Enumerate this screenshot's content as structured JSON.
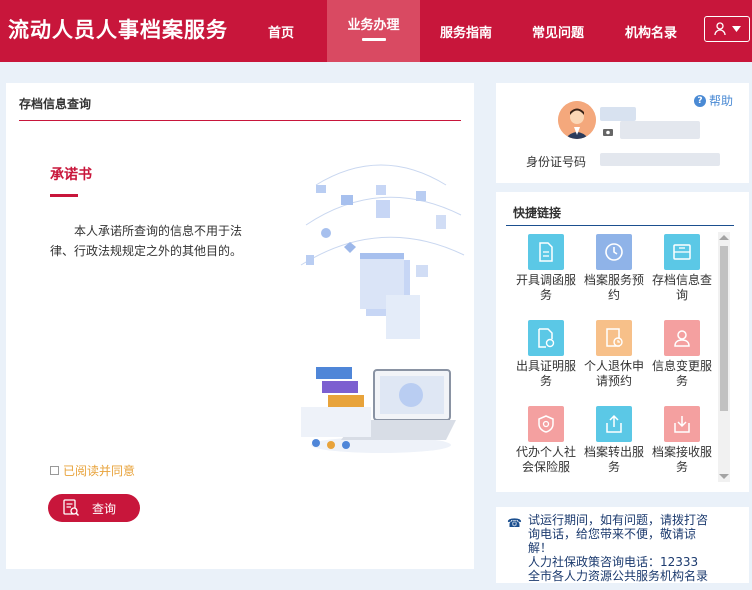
{
  "header": {
    "site_title": "流动人员人事档案服务",
    "nav": [
      "首页",
      "业务办理",
      "服务指南",
      "常见问题",
      "机构名录"
    ],
    "active_nav": "业务办理",
    "user_menu_icon": "user-icon"
  },
  "main": {
    "title": "存档信息查询",
    "pledge_title": "承诺书",
    "pledge_text": "本人承诺所查询的信息不用于法律、行政法规规定之外的其他目的。",
    "agree_label": "已阅读并同意",
    "query_button": "查询"
  },
  "profile": {
    "help": "帮助",
    "id_label": "身份证号码"
  },
  "quick_links": {
    "title": "快捷链接",
    "items": [
      {
        "label": "开具调函服务",
        "icon": "document-icon",
        "color": "#5bc8e6"
      },
      {
        "label": "档案服务预约",
        "icon": "clock-icon",
        "color": "#8fb3e8"
      },
      {
        "label": "存档信息查询",
        "icon": "archive-box-icon",
        "color": "#5bc8e6"
      },
      {
        "label": "出具证明服务",
        "icon": "certificate-icon",
        "color": "#5bc8e6"
      },
      {
        "label": "个人退休申请预约",
        "icon": "retire-form-icon",
        "color": "#f7c089"
      },
      {
        "label": "信息变更服务",
        "icon": "user-edit-icon",
        "color": "#f4a0a0"
      },
      {
        "label": "代办个人社会保险服",
        "icon": "shield-icon",
        "color": "#f4a0a0"
      },
      {
        "label": "档案转出服务",
        "icon": "transfer-out-icon",
        "color": "#5bc8e6"
      },
      {
        "label": "档案接收服务",
        "icon": "transfer-in-icon",
        "color": "#f4a0a0"
      }
    ]
  },
  "notice": {
    "line1": "试运行期间，如有问题，请拨打咨询电话，给您带来不便，敬请谅解！",
    "line2": "人力社保政策咨询电话：12333",
    "line3": "全市各人力资源公共服务机构名录"
  }
}
